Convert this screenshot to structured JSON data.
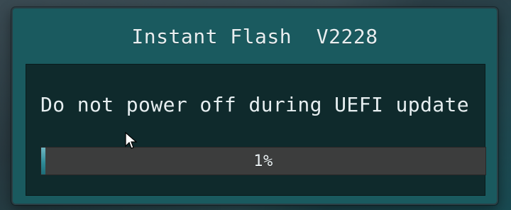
{
  "dialog": {
    "title": "Instant Flash  V2228",
    "message": "Do not power off during UEFI update",
    "progress": {
      "value": 0.01,
      "label": "1%"
    }
  },
  "colors": {
    "dialog_bg": "#1a5a5f",
    "body_bg": "#0f2a2c",
    "text": "#e6eef0",
    "progress_track": "#3c3d3d",
    "progress_fill": "#2f8b97"
  },
  "icons": {
    "cursor": "mouse-pointer-icon"
  }
}
